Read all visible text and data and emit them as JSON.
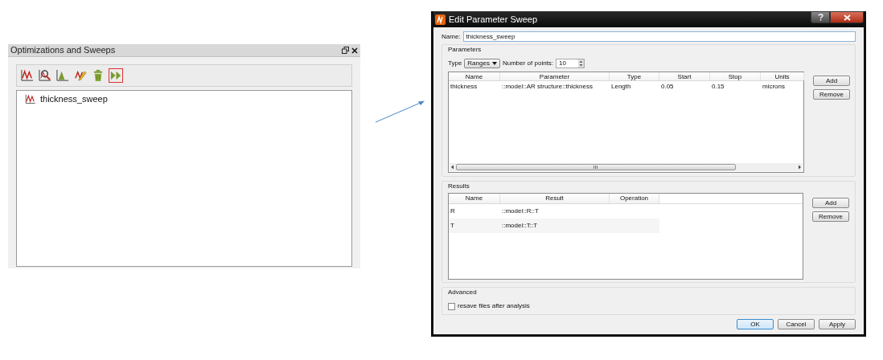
{
  "panel": {
    "title": "Optimizations and Sweeps",
    "toolbar": [
      {
        "kind": "sweep",
        "selected": false
      },
      {
        "kind": "inspect",
        "selected": false
      },
      {
        "kind": "histogram",
        "selected": false
      },
      {
        "kind": "edit",
        "selected": false
      },
      {
        "kind": "delete",
        "selected": false
      },
      {
        "kind": "run",
        "selected": true
      }
    ],
    "items": [
      {
        "label": "thickness_sweep"
      }
    ]
  },
  "dialog": {
    "title": "Edit Parameter Sweep",
    "name_label": "Name:",
    "name_value": "thickness_sweep",
    "parameters": {
      "title": "Parameters",
      "type_label": "Type",
      "type_value": "Ranges",
      "points_label": "Number of points:",
      "points_value": "10",
      "columns": [
        "Name",
        "Parameter",
        "Type",
        "Start",
        "Stop",
        "Units"
      ],
      "rows": [
        [
          "thickness",
          "::model::AR structure::thickness",
          "Length",
          "0.05",
          "0.15",
          "microns"
        ]
      ],
      "buttons": [
        "Add",
        "Remove"
      ]
    },
    "results": {
      "title": "Results",
      "columns": [
        "Name",
        "Result",
        "Operation"
      ],
      "rows": [
        [
          "R",
          "::model::R::T",
          ""
        ],
        [
          "T",
          "::model::T::T",
          ""
        ]
      ],
      "buttons": [
        "Add",
        "Remove"
      ]
    },
    "advanced": {
      "title": "Advanced",
      "option": {
        "label": "resave files after analysis",
        "checked": false
      }
    },
    "buttons": [
      {
        "label": "OK",
        "default": true
      },
      {
        "label": "Cancel",
        "default": false
      },
      {
        "label": "Apply",
        "default": false
      }
    ]
  }
}
